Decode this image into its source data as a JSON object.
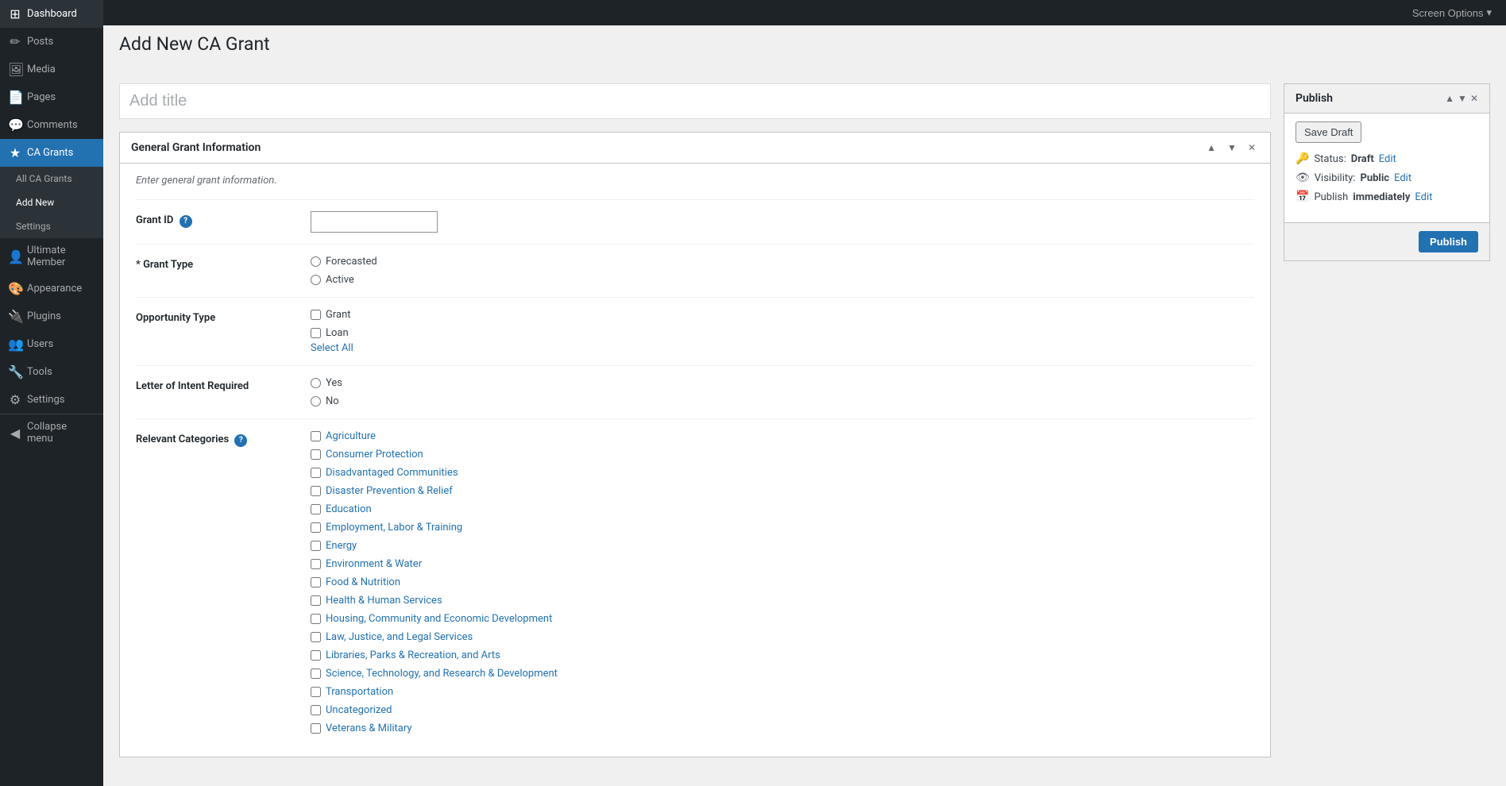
{
  "topbar": {
    "screen_options_label": "Screen Options",
    "screen_options_arrow": "▾"
  },
  "sidebar": {
    "items": [
      {
        "id": "dashboard",
        "label": "Dashboard",
        "icon": "⊞"
      },
      {
        "id": "posts",
        "label": "Posts",
        "icon": "✏"
      },
      {
        "id": "media",
        "label": "Media",
        "icon": "🖼"
      },
      {
        "id": "pages",
        "label": "Pages",
        "icon": "📄"
      },
      {
        "id": "comments",
        "label": "Comments",
        "icon": "💬"
      },
      {
        "id": "ca-grants",
        "label": "CA Grants",
        "icon": "★",
        "active": true
      },
      {
        "id": "ultimate-member",
        "label": "Ultimate Member",
        "icon": "👤"
      },
      {
        "id": "appearance",
        "label": "Appearance",
        "icon": "🎨"
      },
      {
        "id": "plugins",
        "label": "Plugins",
        "icon": "🔌"
      },
      {
        "id": "users",
        "label": "Users",
        "icon": "👥"
      },
      {
        "id": "tools",
        "label": "Tools",
        "icon": "🔧"
      },
      {
        "id": "settings",
        "label": "Settings",
        "icon": "⚙"
      }
    ],
    "ca_grants_submenu": [
      {
        "id": "all-ca-grants",
        "label": "All CA Grants"
      },
      {
        "id": "add-new",
        "label": "Add New",
        "active": true
      },
      {
        "id": "settings",
        "label": "Settings"
      }
    ],
    "collapse_label": "Collapse menu"
  },
  "page": {
    "title": "Add New CA Grant",
    "title_placeholder": "Add title"
  },
  "general_grant_info": {
    "section_title": "General Grant Information",
    "description": "Enter general grant information.",
    "grant_id_label": "Grant ID",
    "grant_type_label": "* Grant Type",
    "grant_type_required": "*",
    "grant_type_options": [
      "Forecasted",
      "Active"
    ],
    "opportunity_type_label": "Opportunity Type",
    "opportunity_type_options": [
      "Grant",
      "Loan"
    ],
    "select_all_label": "Select All",
    "letter_of_intent_label": "Letter of Intent Required",
    "letter_of_intent_options": [
      "Yes",
      "No"
    ],
    "relevant_categories_label": "Relevant Categories",
    "categories": [
      "Agriculture",
      "Consumer Protection",
      "Disadvantaged Communities",
      "Disaster Prevention & Relief",
      "Education",
      "Employment, Labor & Training",
      "Energy",
      "Environment & Water",
      "Food & Nutrition",
      "Health & Human Services",
      "Housing, Community and Economic Development",
      "Law, Justice, and Legal Services",
      "Libraries, Parks & Recreation, and Arts",
      "Science, Technology, and Research & Development",
      "Transportation",
      "Uncategorized",
      "Veterans & Military"
    ]
  },
  "publish_panel": {
    "title": "Publish",
    "save_draft_label": "Save Draft",
    "status_label": "Status:",
    "status_value": "Draft",
    "status_edit": "Edit",
    "visibility_label": "Visibility:",
    "visibility_value": "Public",
    "visibility_edit": "Edit",
    "publish_date_label": "Publish",
    "publish_date_value": "immediately",
    "publish_date_edit": "Edit",
    "publish_btn_label": "Publish"
  }
}
